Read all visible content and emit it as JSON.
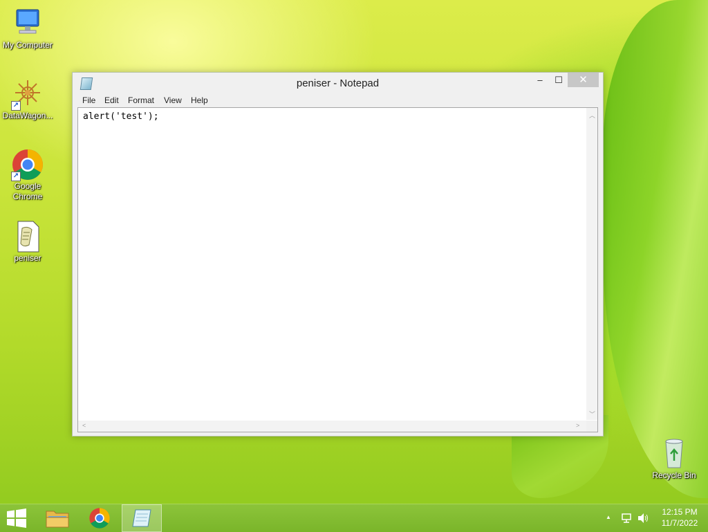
{
  "desktop": {
    "icons": [
      {
        "label": "My Computer"
      },
      {
        "label": "DataWagon..."
      },
      {
        "label": "Google Chrome"
      },
      {
        "label": "peniser"
      },
      {
        "label": "Recycle Bin"
      }
    ]
  },
  "window": {
    "title": "peniser - Notepad",
    "buttons": {
      "minimize": "‒",
      "maximize": "☐",
      "close": "✕"
    },
    "menu": [
      "File",
      "Edit",
      "Format",
      "View",
      "Help"
    ],
    "content": "alert('test');"
  },
  "taskbar": {
    "clock_time": "12:15 PM",
    "clock_date": "11/7/2022",
    "tray_chevron": "▲"
  },
  "colors": {
    "accent": "#7ab52a",
    "window_bg": "#f0f0f0",
    "close_button": "#c7c7c7"
  }
}
